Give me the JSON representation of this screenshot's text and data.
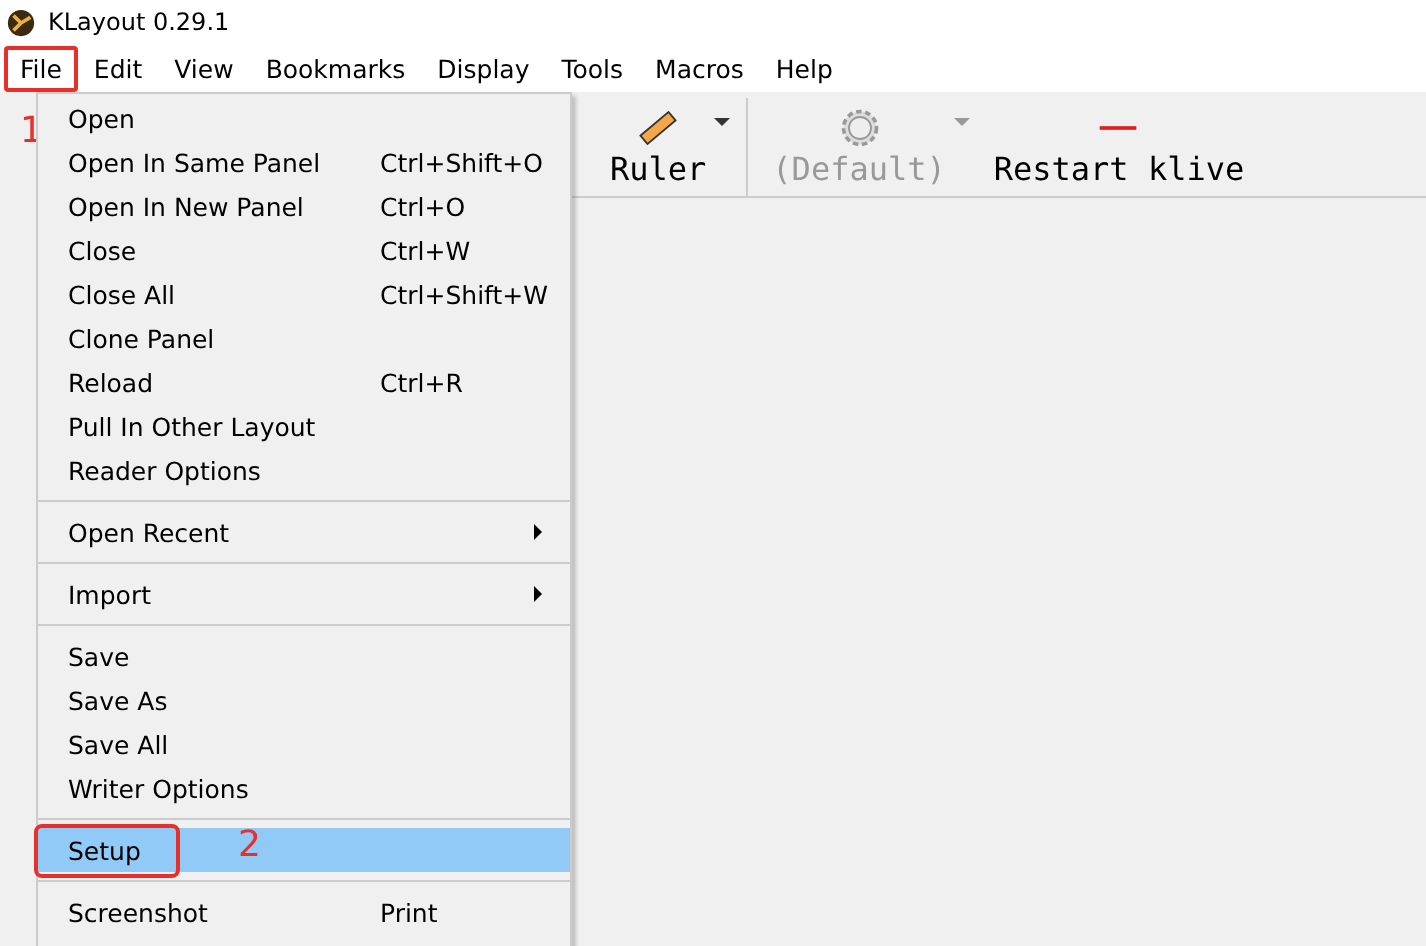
{
  "window": {
    "title": "KLayout 0.29.1"
  },
  "menubar": [
    {
      "label": "File",
      "selected": true,
      "callout": "1"
    },
    {
      "label": "Edit",
      "selected": false
    },
    {
      "label": "View",
      "selected": false
    },
    {
      "label": "Bookmarks",
      "selected": false
    },
    {
      "label": "Display",
      "selected": false
    },
    {
      "label": "Tools",
      "selected": false
    },
    {
      "label": "Macros",
      "selected": false
    },
    {
      "label": "Help",
      "selected": false
    }
  ],
  "toolbar": [
    {
      "kind": "ruler",
      "label": "Ruler",
      "disabled": false,
      "dropdown": true
    },
    {
      "kind": "template",
      "label": "(Default)",
      "disabled": true,
      "dropdown": true
    },
    {
      "kind": "live",
      "label": "Restart klive",
      "disabled": false,
      "dropdown": false
    }
  ],
  "file_menu": [
    {
      "kind": "item",
      "label": "Open",
      "selected": false
    },
    {
      "kind": "item",
      "label": "Open In Same Panel",
      "shortcut": "Ctrl+Shift+O",
      "selected": false
    },
    {
      "kind": "item",
      "label": "Open In New Panel",
      "shortcut": "Ctrl+O",
      "selected": false
    },
    {
      "kind": "item",
      "label": "Close",
      "shortcut": "Ctrl+W",
      "selected": false
    },
    {
      "kind": "item",
      "label": "Close All",
      "shortcut": "Ctrl+Shift+W",
      "selected": false
    },
    {
      "kind": "item",
      "label": "Clone Panel",
      "selected": false
    },
    {
      "kind": "item",
      "label": "Reload",
      "shortcut": "Ctrl+R",
      "selected": false
    },
    {
      "kind": "item",
      "label": "Pull In Other Layout",
      "selected": false
    },
    {
      "kind": "item",
      "label": "Reader Options",
      "selected": false
    },
    {
      "kind": "separator"
    },
    {
      "kind": "submenu",
      "label": "Open Recent",
      "selected": false
    },
    {
      "kind": "separator"
    },
    {
      "kind": "submenu",
      "label": "Import",
      "selected": false
    },
    {
      "kind": "separator"
    },
    {
      "kind": "item",
      "label": "Save",
      "selected": false
    },
    {
      "kind": "item",
      "label": "Save As",
      "selected": false
    },
    {
      "kind": "item",
      "label": "Save All",
      "selected": false
    },
    {
      "kind": "item",
      "label": "Writer Options",
      "selected": false
    },
    {
      "kind": "separator"
    },
    {
      "kind": "item",
      "label": "Setup",
      "selected": true,
      "callout": "2"
    },
    {
      "kind": "separator"
    },
    {
      "kind": "item",
      "label": "Screenshot",
      "shortcut": "Print",
      "selected": false
    }
  ]
}
